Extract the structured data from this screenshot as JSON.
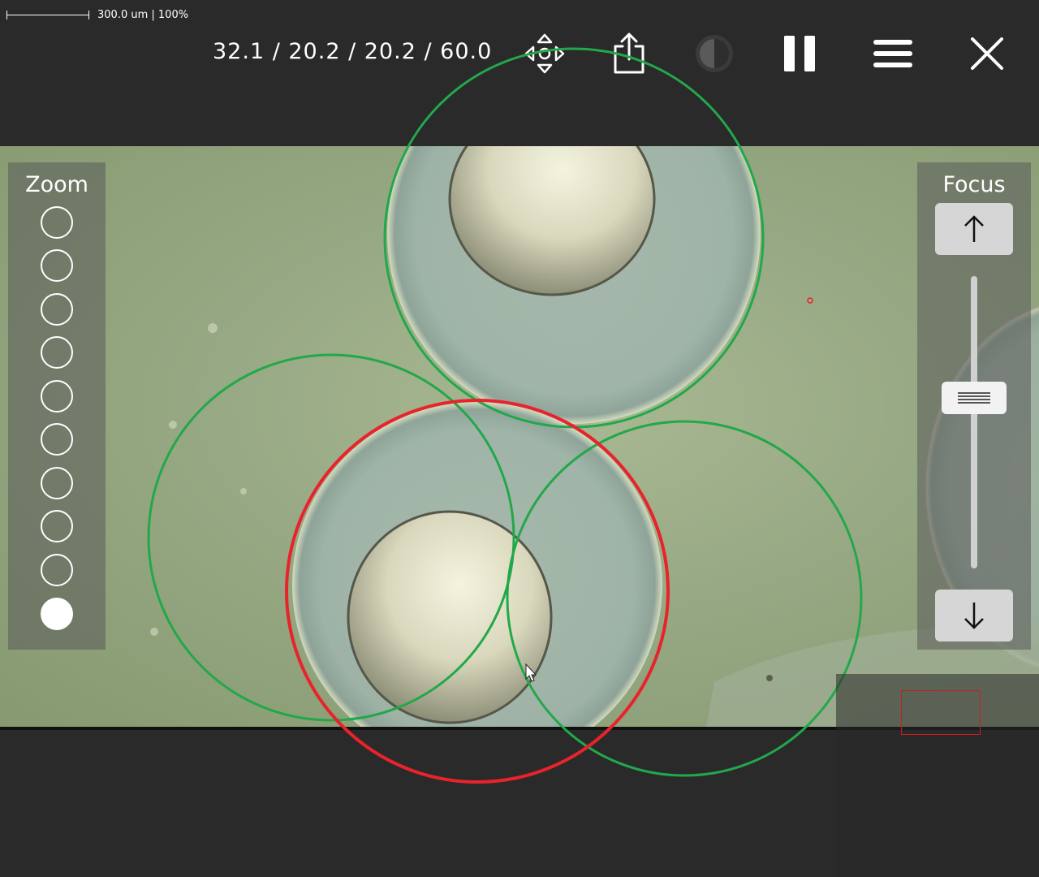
{
  "scale_bar": {
    "label": "300.0 um | 100%"
  },
  "toolbar": {
    "coords": "32.1 / 20.2 / 20.2 / 60.0",
    "icons": [
      "move-icon",
      "share-icon",
      "contrast-icon",
      "pause-icon",
      "menu-icon",
      "close-icon"
    ]
  },
  "zoom": {
    "title": "Zoom",
    "levels": 10,
    "active_level": 10
  },
  "focus": {
    "title": "Focus",
    "up_icon": "arrow-up-icon",
    "down_icon": "arrow-down-icon",
    "slider_level": 0.42
  },
  "colors": {
    "selected_circle": "#e8232b",
    "candidate_circle": "#22a84a",
    "background": "#2a2a2a",
    "minimap_marker": "#c81e1e"
  }
}
